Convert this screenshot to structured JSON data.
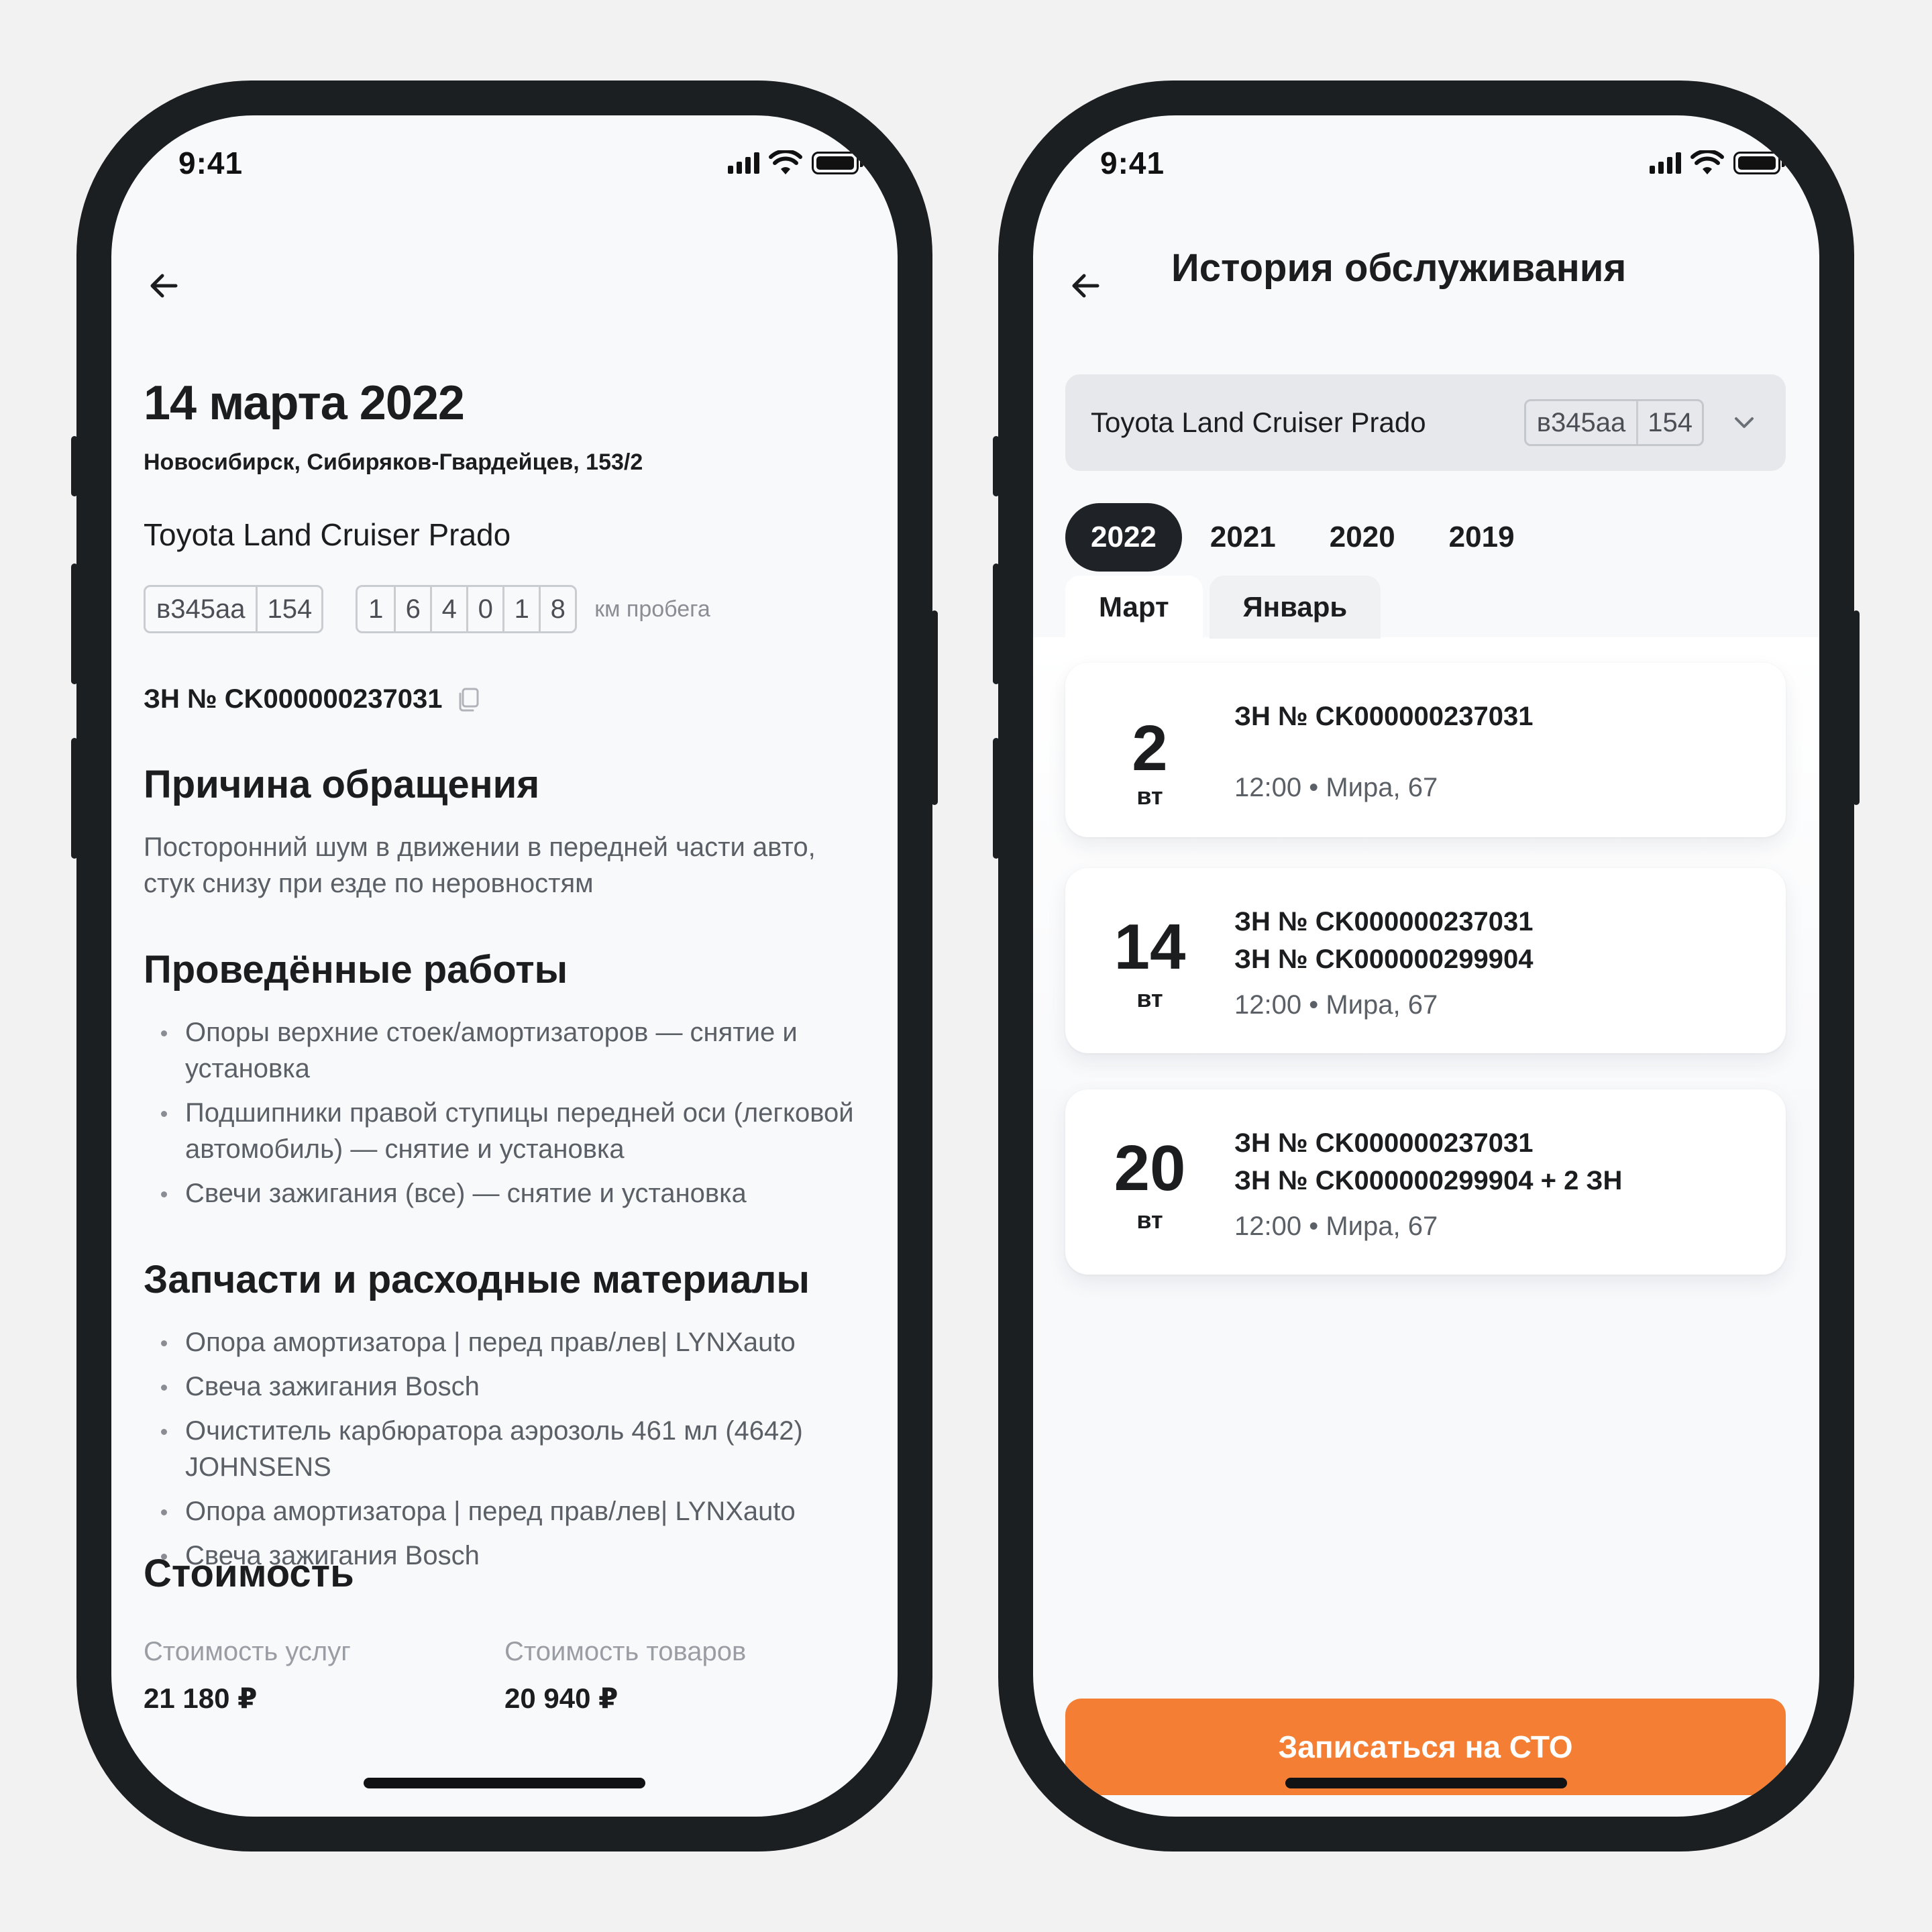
{
  "status": {
    "time": "9:41"
  },
  "detail": {
    "date": "14 марта 2022",
    "address": "Новосибирск, Сибиряков-Гвардейцев, 153/2",
    "car": "Toyota Land Cruiser Prado",
    "plate": {
      "number": "в345аа",
      "region": "154"
    },
    "odometer_digits": [
      "1",
      "6",
      "4",
      "0",
      "1",
      "8"
    ],
    "odometer_label": "км пробега",
    "order_number": "ЗН № CK000000237031",
    "reason_title": "Причина обращения",
    "reason_text": "Посторонний шум в движении в передней части авто, стук снизу при езде по неровностям",
    "works_title": "Проведённые работы",
    "works": [
      "Опоры верхние стоек/амортизаторов — снятие и установка",
      "Подшипники правой ступицы передней оси (легковой автомобиль) — снятие и установка",
      "Свечи зажигания (все) — снятие и установка"
    ],
    "parts_title": "Запчасти и расходные материалы",
    "parts": [
      "Опора амортизатора | перед прав/лев| LYNXauto",
      "Свеча зажигания Bosch",
      "Очиститель карбюратора аэрозоль 461 мл (4642) JOHNSENS",
      "Опора амортизатора | перед прав/лев| LYNXauto",
      "Свеча зажигания Bosch"
    ],
    "cost_title": "Стоимость",
    "services_cost_label": "Стоимость услуг",
    "services_cost": "21 180 ₽",
    "goods_cost_label": "Стоимость товаров",
    "goods_cost": "20 940 ₽"
  },
  "history": {
    "title": "История обслуживания",
    "car_select": {
      "car": "Toyota Land Cruiser Prado",
      "plate": {
        "number": "в345аа",
        "region": "154"
      }
    },
    "years": [
      {
        "label": "2022",
        "active": true
      },
      {
        "label": "2021",
        "active": false
      },
      {
        "label": "2020",
        "active": false
      },
      {
        "label": "2019",
        "active": false
      }
    ],
    "months": [
      {
        "label": "Март",
        "active": true
      },
      {
        "label": "Январь",
        "active": false
      }
    ],
    "visits": [
      {
        "day": "2",
        "weekday": "вт",
        "orders": [
          "ЗН № CK000000237031"
        ],
        "meta": "12:00 • Мира, 67"
      },
      {
        "day": "14",
        "weekday": "вт",
        "orders": [
          "ЗН № CK000000237031",
          "ЗН № CK000000299904"
        ],
        "meta": "12:00 • Мира, 67"
      },
      {
        "day": "20",
        "weekday": "вт",
        "orders": [
          "ЗН № CK000000237031",
          "ЗН № CK000000299904 + 2 ЗН"
        ],
        "meta": "12:00 • Мира, 67"
      }
    ],
    "book_button": "Записаться на СТО"
  }
}
